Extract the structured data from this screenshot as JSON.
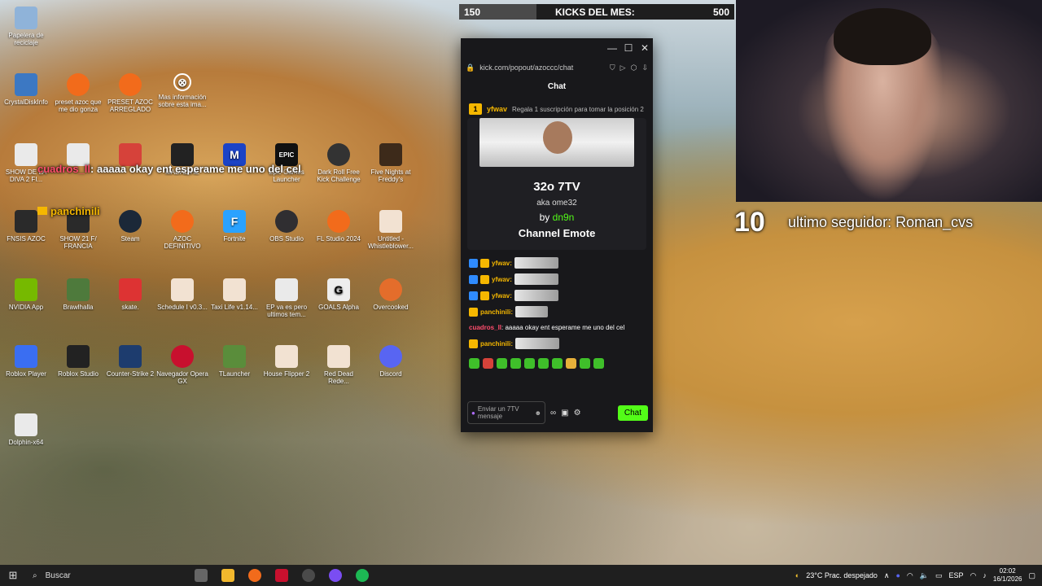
{
  "desktop": {
    "icons": [
      {
        "label": "Papelera de reciclaje",
        "color": "#8fb3d9"
      },
      {
        "label": "CrystalDiskInfo",
        "color": "#3c78c3"
      },
      {
        "label": "preset azoc que me dio gonza",
        "color": "#f26b1b"
      },
      {
        "label": "PRESET AZOC ARREGLADO",
        "color": "#f26b1b"
      },
      {
        "label": "Mas información sobre esta ima...",
        "color": "rgba(0,0,0,0)"
      },
      {
        "label": "SHOW DE LA DIVA 2 FI...",
        "color": "#eaeaea"
      },
      {
        "label": "",
        "color": "#eaeaea"
      },
      {
        "label": "",
        "color": "#d6423a"
      },
      {
        "label": "MADAZ-HE",
        "color": "#222"
      },
      {
        "label": "",
        "color": "#1b43c6"
      },
      {
        "label": "Epic Games Launcher",
        "color": "#111"
      },
      {
        "label": "Dark Roll Free Kick Challenge",
        "color": "#333"
      },
      {
        "label": "Five Nights at Freddy's",
        "color": "#3d2a1a"
      },
      {
        "label": "FNSIS AZOC",
        "color": "#2a2a2a"
      },
      {
        "label": "SHOW 21 F/ FRANCIA",
        "color": "#2a2a2a"
      },
      {
        "label": "Steam",
        "color": "#1b2838"
      },
      {
        "label": "AZOC DEFINITIVO",
        "color": "#f26b1b"
      },
      {
        "label": "Fortnite",
        "color": "#2aa2ff"
      },
      {
        "label": "OBS Studio",
        "color": "#302e31"
      },
      {
        "label": "FL Studio 2024",
        "color": "#f26b1b"
      },
      {
        "label": "Untitled - Whistleblower...",
        "color": "#f2e2d2"
      },
      {
        "label": "NVIDIA App",
        "color": "#76b900"
      },
      {
        "label": "Brawlhalla",
        "color": "#4e7a3c"
      },
      {
        "label": "skate.",
        "color": "#d33"
      },
      {
        "label": "Schedule I v0.3...",
        "color": "#f2e2d2"
      },
      {
        "label": "Taxi Life v1.14...",
        "color": "#f2e2d2"
      },
      {
        "label": "EP va es pero ultimos tem...",
        "color": "#eaeaea"
      },
      {
        "label": "GOALS Alpha",
        "color": "#eee"
      },
      {
        "label": "Overcooked",
        "color": "#e46d2b"
      },
      {
        "label": "Roblox Player",
        "color": "#3a6ef2"
      },
      {
        "label": "Roblox Studio",
        "color": "#222"
      },
      {
        "label": "Counter-Strike 2",
        "color": "#1d3c6e"
      },
      {
        "label": "Navegador Opera GX",
        "color": "#c8102e"
      },
      {
        "label": "TLauncher",
        "color": "#5a8d3b"
      },
      {
        "label": "House Flipper 2",
        "color": "#f2e2d2"
      },
      {
        "label": "Red Dead Rede...",
        "color": "#f2e2d2"
      },
      {
        "label": "Discord",
        "color": "#5865f2"
      },
      {
        "label": "Dolphin-x64",
        "color": "#eaeaea"
      }
    ]
  },
  "overlay": {
    "kicks_min": "150",
    "kicks_title": "KICKS DEL MES:",
    "kicks_max": "500",
    "kicks_progress": 0.28,
    "alert_user": "cuadros_ll",
    "alert_text": ": aaaaa okay ent esperame me uno del cel",
    "alert_user2": "panchinili",
    "counter": "10",
    "last_follower": "ultimo seguidor: Roman_cvs"
  },
  "chat_window": {
    "url": "kick.com/popout/azoccc/chat",
    "header": "Chat",
    "pinned": {
      "user": "yfwav",
      "message": "Regala 1 suscripción para tomar la posición 2"
    },
    "emote": {
      "name": "32o 7TV",
      "aka": "aka ome32",
      "by_prefix": "by",
      "by_user": "dn9n",
      "type": "Channel Emote"
    },
    "messages": [
      {
        "user": "yfwav:",
        "badge": "blue"
      },
      {
        "user": "yfwav:",
        "badge": "blue"
      },
      {
        "user": "yfwav:",
        "badge": "blue"
      },
      {
        "user": "panchinili:",
        "badge": "gold"
      }
    ],
    "text_message": {
      "user": "cuadros_ll",
      "text": ": aaaaa okay ent esperame me uno del cel"
    },
    "last_message_user": "panchinili:",
    "input_placeholder": "Enviar un 7TV mensaje",
    "send_button": "Chat"
  },
  "taskbar": {
    "search_label": "Buscar",
    "weather": "23°C  Prac. despejado",
    "lang": "ESP",
    "time": "02:02",
    "date": "16/1/2026"
  }
}
